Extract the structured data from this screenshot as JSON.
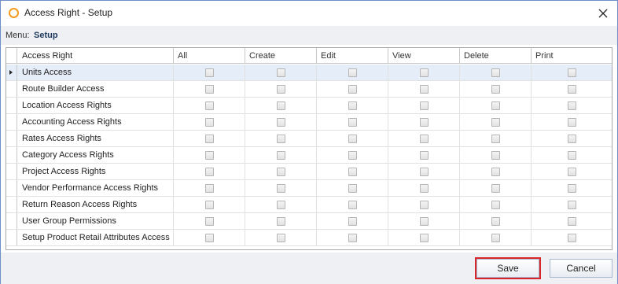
{
  "window": {
    "title": "Access Right - Setup",
    "colors": {
      "title_icon": "#f39a1f",
      "border": "#6c90c6",
      "save_highlight": "#d8262a"
    }
  },
  "menu": {
    "label": "Menu:",
    "value": "Setup"
  },
  "grid": {
    "columns": [
      "Access Right",
      "All",
      "Create",
      "Edit",
      "View",
      "Delete",
      "Print"
    ],
    "focused_row": 0,
    "rows": [
      {
        "name": "Units Access",
        "all": false,
        "create": false,
        "edit": false,
        "view": false,
        "delete": false,
        "print": false
      },
      {
        "name": "Route Builder Access",
        "all": false,
        "create": false,
        "edit": false,
        "view": false,
        "delete": false,
        "print": false
      },
      {
        "name": "Location Access Rights",
        "all": false,
        "create": false,
        "edit": false,
        "view": false,
        "delete": false,
        "print": false
      },
      {
        "name": "Accounting Access Rights",
        "all": false,
        "create": false,
        "edit": false,
        "view": false,
        "delete": false,
        "print": false
      },
      {
        "name": "Rates Access Rights",
        "all": false,
        "create": false,
        "edit": false,
        "view": false,
        "delete": false,
        "print": false
      },
      {
        "name": "Category Access Rights",
        "all": false,
        "create": false,
        "edit": false,
        "view": false,
        "delete": false,
        "print": false
      },
      {
        "name": "Project Access Rights",
        "all": false,
        "create": false,
        "edit": false,
        "view": false,
        "delete": false,
        "print": false
      },
      {
        "name": "Vendor Performance Access Rights",
        "all": false,
        "create": false,
        "edit": false,
        "view": false,
        "delete": false,
        "print": false
      },
      {
        "name": "Return Reason Access Rights",
        "all": false,
        "create": false,
        "edit": false,
        "view": false,
        "delete": false,
        "print": false
      },
      {
        "name": "User Group Permissions",
        "all": false,
        "create": false,
        "edit": false,
        "view": false,
        "delete": false,
        "print": false
      },
      {
        "name": "Setup Product Retail Attributes Access",
        "all": false,
        "create": false,
        "edit": false,
        "view": false,
        "delete": false,
        "print": false
      }
    ]
  },
  "buttons": {
    "save": "Save",
    "cancel": "Cancel"
  },
  "icons": {
    "title": "app-ring-icon",
    "close": "close-icon",
    "row_indicator": "row-pointer-icon"
  }
}
